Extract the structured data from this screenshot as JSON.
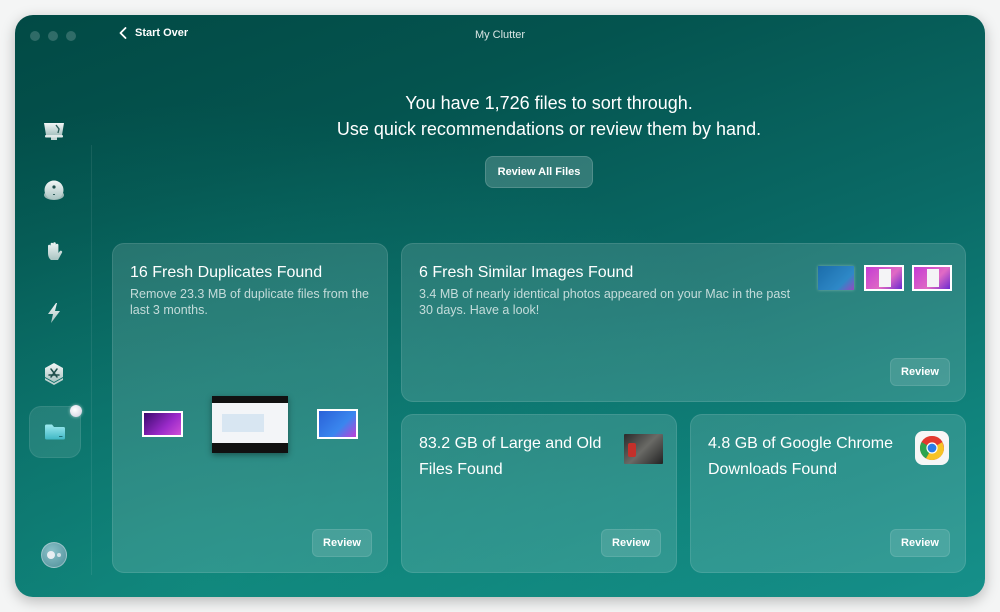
{
  "window": {
    "title": "My Clutter",
    "back_label": "Start Over"
  },
  "sidebar": {
    "items": [
      {
        "name": "smart-care",
        "icon": "imac-icon"
      },
      {
        "name": "cleanup",
        "icon": "disk-icon"
      },
      {
        "name": "protection",
        "icon": "hand-icon"
      },
      {
        "name": "performance",
        "icon": "lightning-icon"
      },
      {
        "name": "applications",
        "icon": "app-store-icon"
      },
      {
        "name": "my-clutter",
        "icon": "folder-icon",
        "active": true,
        "badge": true
      }
    ],
    "assistant_icon": "assistant-icon"
  },
  "header": {
    "line1": "You have 1,726 files to sort through.",
    "line2": "Use quick recommendations or review them by hand.",
    "review_all_label": "Review All Files"
  },
  "cards": [
    {
      "title": "16 Fresh Duplicates Found",
      "description": "Remove 23.3 MB of duplicate files from the last 3 months.",
      "button": "Review"
    },
    {
      "title": "6 Fresh Similar Images Found",
      "description": "3.4 MB of nearly identical photos appeared on your Mac in the past 30 days. Have a look!",
      "button": "Review"
    },
    {
      "title": "83.2 GB of Large and Old Files Found",
      "button": "Review"
    },
    {
      "title": "4.8 GB of Google Chrome Downloads Found",
      "icon": "chrome-icon",
      "button": "Review"
    }
  ]
}
